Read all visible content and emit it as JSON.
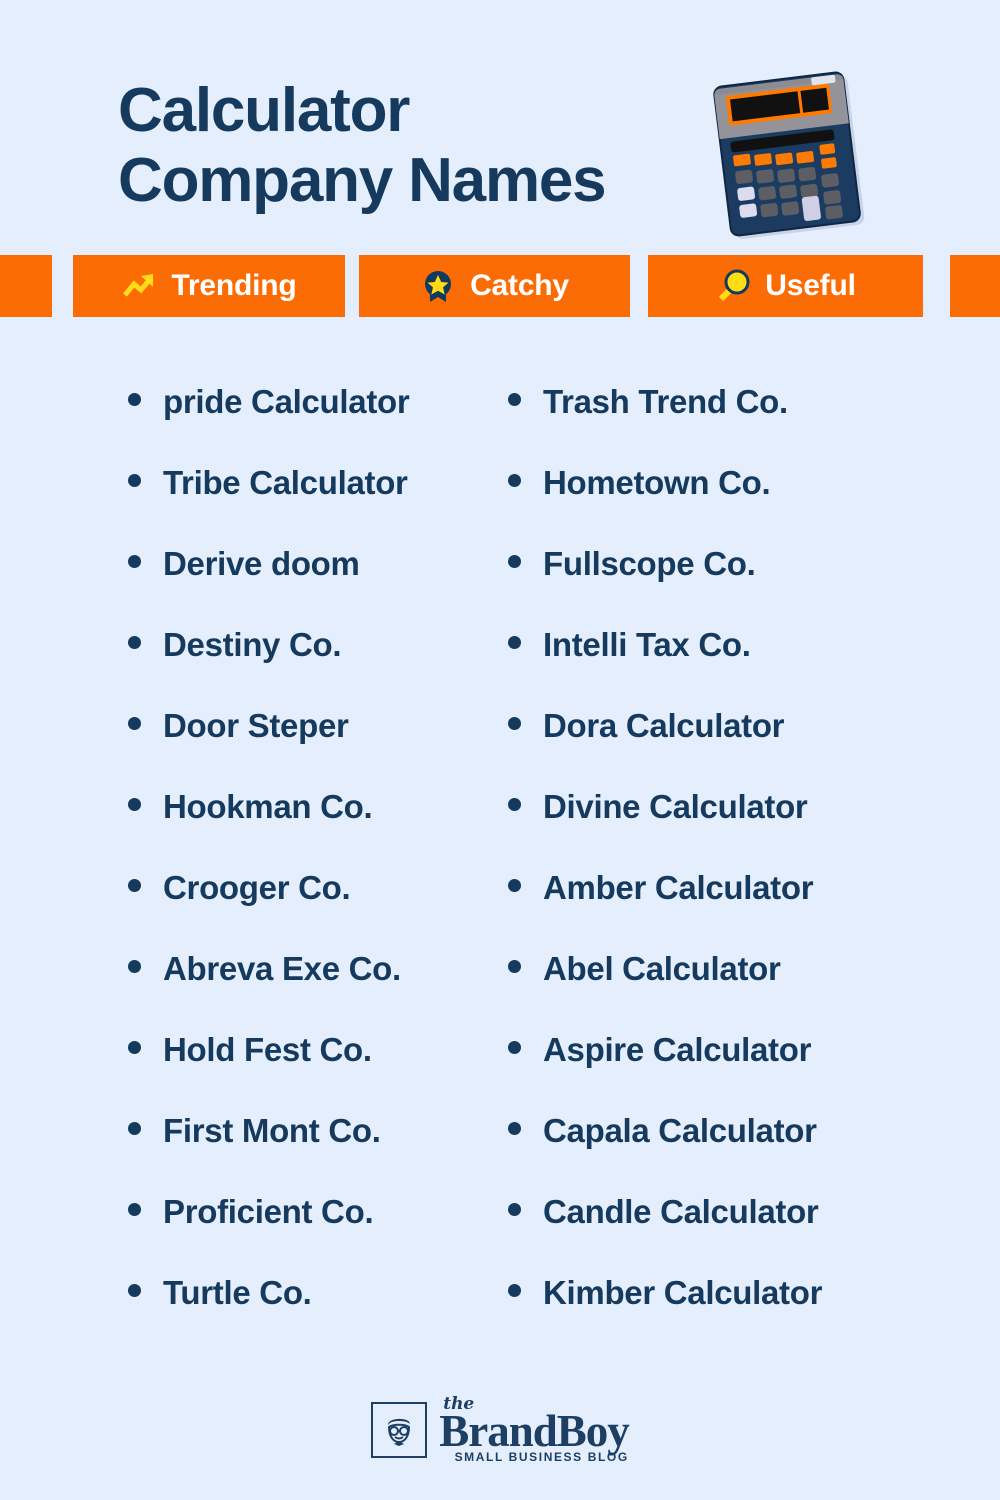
{
  "page": {
    "background_color": "#e4eefc",
    "accent_color": "#fc6c05",
    "navy_color": "#153a5e",
    "yellow_color": "#ffdd14"
  },
  "header": {
    "title_line1": "Calculator",
    "title_line2": "Company Names",
    "illustration": "calculator-illustration"
  },
  "badges": [
    {
      "label": "Trending",
      "icon": "trending-up-icon"
    },
    {
      "label": "Catchy",
      "icon": "award-star-icon"
    },
    {
      "label": "Useful",
      "icon": "magnifier-icon"
    }
  ],
  "lists": {
    "left_column": [
      "pride Calculator",
      "Tribe Calculator",
      "Derive doom",
      "Destiny Co.",
      "Door Steper",
      "Hookman Co.",
      "Crooger Co.",
      "Abreva Exe Co.",
      "Hold Fest Co.",
      "First Mont Co.",
      "Proficient Co.",
      "Turtle Co."
    ],
    "right_column": [
      "Trash Trend Co.",
      "Hometown Co.",
      "Fullscope Co.",
      "Intelli Tax Co.",
      "Dora Calculator",
      "Divine Calculator",
      "Amber Calculator",
      "Abel Calculator",
      "Aspire Calculator",
      "Capala Calculator",
      "Candle Calculator",
      "Kimber Calculator"
    ]
  },
  "footer": {
    "logo_the": "the",
    "logo_name": "BrandBoy",
    "logo_tagline": "SMALL BUSINESS BLOG",
    "logo_mark": "boy-face-icon"
  }
}
